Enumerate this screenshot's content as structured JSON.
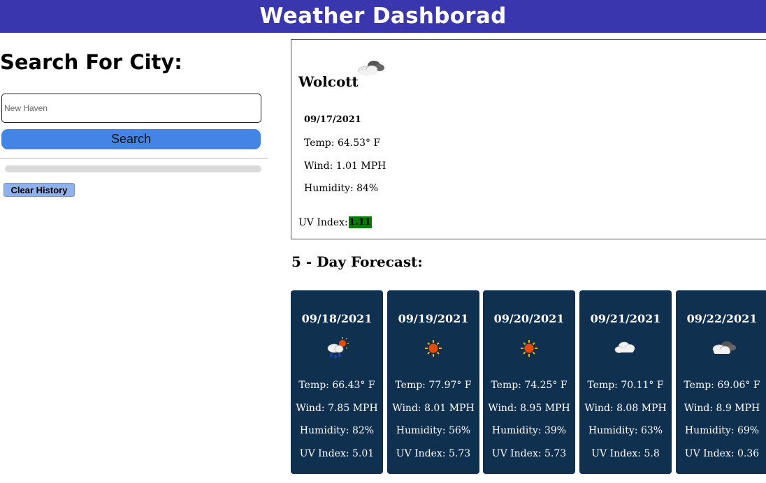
{
  "header": {
    "title": "Weather Dashborad"
  },
  "search": {
    "title": "Search For City:",
    "placeholder": "New Haven",
    "button_label": "Search",
    "clear_label": "Clear History"
  },
  "current": {
    "city": "Wolcott",
    "icon": "partly-cloudy-icon",
    "date": "09/17/2021",
    "temp": "Temp: 64.53° F",
    "wind": "Wind: 1.01 MPH",
    "humidity": "Humidity: 84%",
    "uv_label": "UV Index:",
    "uv_value": "1.11",
    "uv_color": "#007d00"
  },
  "forecast": {
    "title": "5 - Day Forecast:",
    "card_color": "#10304f",
    "days": [
      {
        "date": "09/18/2021",
        "icon": "rain-sun-icon",
        "temp": "Temp: 66.43° F",
        "wind": "Wind: 7.85 MPH",
        "humidity": "Humidity: 82%",
        "uv": "UV Index: 5.01"
      },
      {
        "date": "09/19/2021",
        "icon": "sun-icon",
        "temp": "Temp: 77.97° F",
        "wind": "Wind: 8.01 MPH",
        "humidity": "Humidity: 56%",
        "uv": "UV Index: 5.73"
      },
      {
        "date": "09/20/2021",
        "icon": "sun-icon",
        "temp": "Temp: 74.25° F",
        "wind": "Wind: 8.95 MPH",
        "humidity": "Humidity: 39%",
        "uv": "UV Index: 5.73"
      },
      {
        "date": "09/21/2021",
        "icon": "cloud-icon",
        "temp": "Temp: 70.11° F",
        "wind": "Wind: 8.08 MPH",
        "humidity": "Humidity: 63%",
        "uv": "UV Index: 5.8"
      },
      {
        "date": "09/22/2021",
        "icon": "broken-clouds-icon",
        "temp": "Temp: 69.06° F",
        "wind": "Wind: 8.9 MPH",
        "humidity": "Humidity: 69%",
        "uv": "UV Index: 0.36"
      }
    ]
  }
}
